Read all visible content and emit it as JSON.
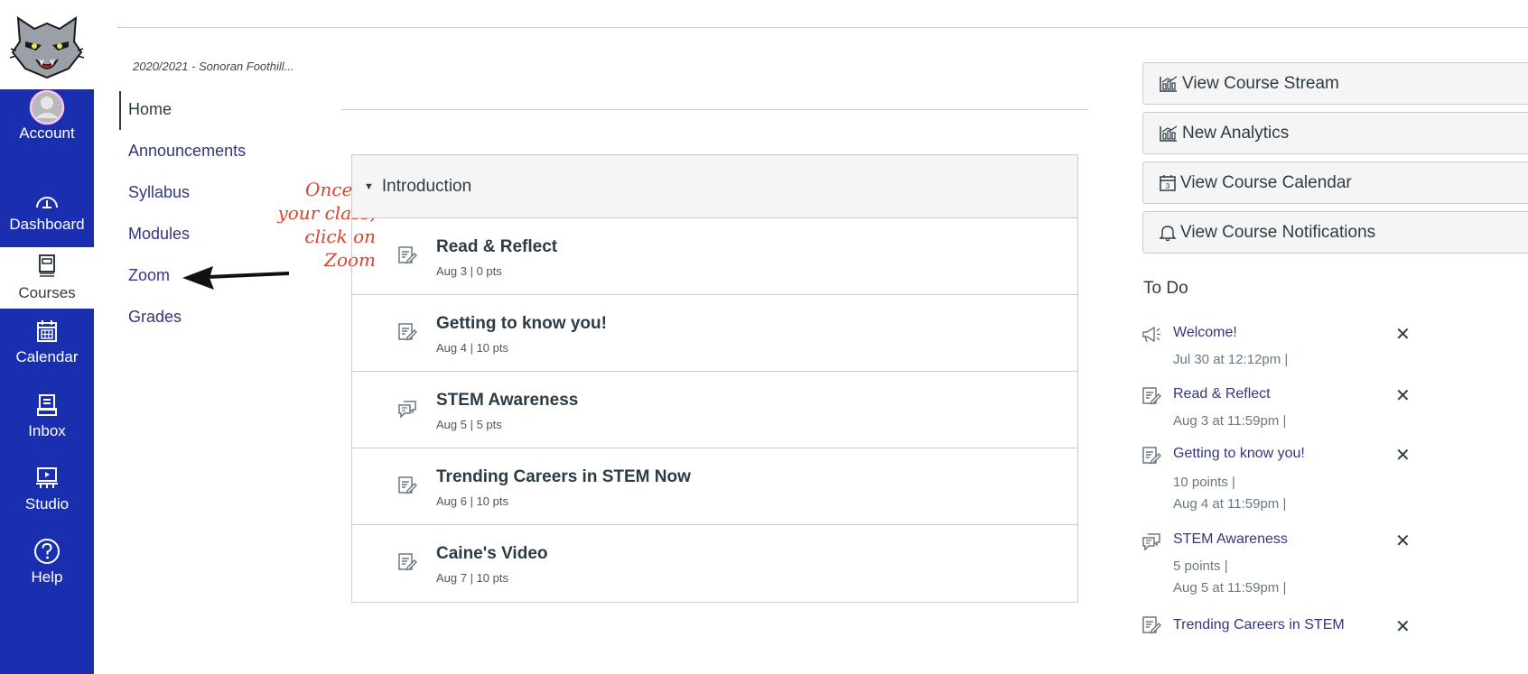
{
  "global_nav": {
    "items": [
      {
        "label": "Account",
        "icon": "avatar-icon"
      },
      {
        "label": "Dashboard",
        "icon": "dashboard-icon"
      },
      {
        "label": "Courses",
        "icon": "courses-icon"
      },
      {
        "label": "Calendar",
        "icon": "calendar-icon"
      },
      {
        "label": "Inbox",
        "icon": "inbox-icon"
      },
      {
        "label": "Studio",
        "icon": "studio-icon"
      },
      {
        "label": "Help",
        "icon": "help-icon"
      }
    ],
    "active": "Courses",
    "brand_color": "#1a2fb0"
  },
  "breadcrumb": "2020/2021 - Sonoran Foothill...",
  "course_nav": {
    "items": [
      "Home",
      "Announcements",
      "Syllabus",
      "Modules",
      "Zoom",
      "Grades"
    ],
    "active": "Home"
  },
  "annotation": {
    "lines": [
      "Once in",
      "your class,",
      "click on",
      "Zoom"
    ],
    "color": "#d9442e"
  },
  "module": {
    "title": "Introduction",
    "items": [
      {
        "title": "Read & Reflect",
        "meta": "Aug 3  |  0 pts",
        "icon": "assignment-icon"
      },
      {
        "title": "Getting to know you!",
        "meta": "Aug 4  |  10 pts",
        "icon": "assignment-icon"
      },
      {
        "title": "STEM Awareness",
        "meta": "Aug 5  |  5 pts",
        "icon": "discussion-icon"
      },
      {
        "title": "Trending Careers in STEM Now",
        "meta": "Aug 6  |  10 pts",
        "icon": "assignment-icon"
      },
      {
        "title": "Caine's Video",
        "meta": "Aug 7  |  10 pts",
        "icon": "assignment-icon"
      }
    ]
  },
  "sidebar": {
    "buttons": [
      {
        "label": "View Course Stream",
        "icon": "analytics-icon"
      },
      {
        "label": "New Analytics",
        "icon": "analytics-icon"
      },
      {
        "label": "View Course Calendar",
        "icon": "calendar-icon"
      },
      {
        "label": "View Course Notifications",
        "icon": "bell-icon"
      }
    ],
    "todo_title": "To Do",
    "todo": [
      {
        "title": "Welcome!",
        "lines": [
          "Jul 30 at 12:12pm  |"
        ],
        "icon": "announcement-icon"
      },
      {
        "title": "Read & Reflect",
        "lines": [
          "Aug 3 at 11:59pm  |"
        ],
        "icon": "assignment-icon"
      },
      {
        "title": "Getting to know you!",
        "lines": [
          "10 points  |",
          "Aug 4 at 11:59pm  |"
        ],
        "icon": "assignment-icon"
      },
      {
        "title": "STEM Awareness",
        "lines": [
          "5 points  |",
          "Aug 5 at 11:59pm  |"
        ],
        "icon": "discussion-icon"
      },
      {
        "title": "Trending Careers in STEM",
        "lines": [],
        "icon": "assignment-icon"
      }
    ],
    "dismiss_glyph": "✕"
  }
}
